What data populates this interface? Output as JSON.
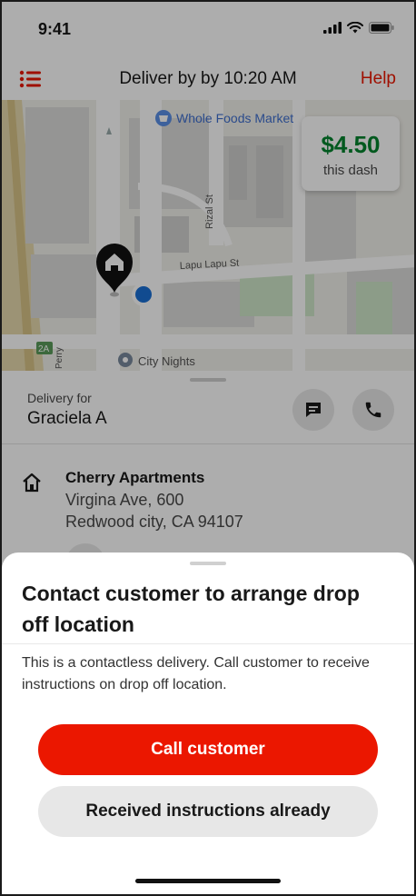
{
  "status_bar": {
    "time": "9:41"
  },
  "header": {
    "title": "Deliver by by 10:20 AM",
    "help_label": "Help"
  },
  "map": {
    "labels": {
      "store": "Whole Foods Market",
      "street_rizal": "Rizal St",
      "street_lapu": "Lapu Lapu St",
      "place_city_nights": "City Nights",
      "route_badge": "2A",
      "street_perry": "Perry"
    },
    "earnings": {
      "amount": "$4.50",
      "label": "this dash"
    }
  },
  "delivery": {
    "for_label": "Delivery for",
    "customer_name": "Graciela A",
    "address": {
      "name": "Cherry Apartments",
      "line1": "Virgina Ave, 600",
      "line2": "Redwood city, CA 94107"
    }
  },
  "sheet": {
    "title": "Contact customer to arrange drop off location",
    "body": "This is a contactless delivery. Call customer to receive instructions on drop off location.",
    "primary_button": "Call customer",
    "secondary_button": "Received instructions already"
  },
  "colors": {
    "brand_red": "#eb1700",
    "earnings_green": "#00832d",
    "location_blue": "#1a6fd4"
  }
}
